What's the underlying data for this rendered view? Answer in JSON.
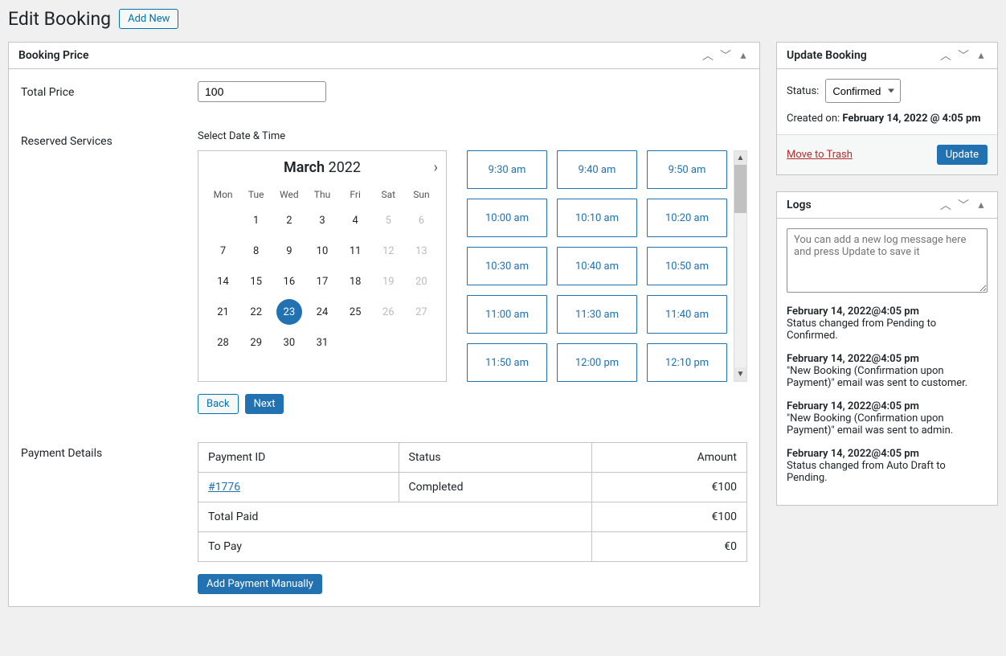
{
  "header": {
    "title": "Edit Booking",
    "add_new": "Add New"
  },
  "booking_price_panel": {
    "title": "Booking Price"
  },
  "total_price": {
    "label": "Total Price",
    "value": "100"
  },
  "reserved_services": {
    "label": "Reserved Services",
    "select_label": "Select Date & Time"
  },
  "calendar": {
    "month": "March",
    "year": "2022",
    "dow": [
      "Mon",
      "Tue",
      "Wed",
      "Thu",
      "Fri",
      "Sat",
      "Sun"
    ],
    "weeks": [
      [
        {
          "d": ""
        },
        {
          "d": "1"
        },
        {
          "d": "2"
        },
        {
          "d": "3"
        },
        {
          "d": "4"
        },
        {
          "d": "5",
          "dis": true
        },
        {
          "d": "6",
          "dis": true
        }
      ],
      [
        {
          "d": "7"
        },
        {
          "d": "8"
        },
        {
          "d": "9"
        },
        {
          "d": "10"
        },
        {
          "d": "11"
        },
        {
          "d": "12",
          "dis": true
        },
        {
          "d": "13",
          "dis": true
        }
      ],
      [
        {
          "d": "14"
        },
        {
          "d": "15"
        },
        {
          "d": "16"
        },
        {
          "d": "17"
        },
        {
          "d": "18"
        },
        {
          "d": "19",
          "dis": true
        },
        {
          "d": "20",
          "dis": true
        }
      ],
      [
        {
          "d": "21"
        },
        {
          "d": "22"
        },
        {
          "d": "23",
          "sel": true
        },
        {
          "d": "24"
        },
        {
          "d": "25"
        },
        {
          "d": "26",
          "dis": true
        },
        {
          "d": "27",
          "dis": true
        }
      ],
      [
        {
          "d": "28"
        },
        {
          "d": "29"
        },
        {
          "d": "30"
        },
        {
          "d": "31"
        },
        {
          "d": ""
        },
        {
          "d": ""
        },
        {
          "d": ""
        }
      ]
    ]
  },
  "timeslots": [
    "9:30 am",
    "9:40 am",
    "9:50 am",
    "10:00 am",
    "10:10 am",
    "10:20 am",
    "10:30 am",
    "10:40 am",
    "10:50 am",
    "11:00 am",
    "11:30 am",
    "11:40 am",
    "11:50 am",
    "12:00 pm",
    "12:10 pm"
  ],
  "nav": {
    "back": "Back",
    "next": "Next"
  },
  "payment": {
    "label": "Payment Details",
    "headers": {
      "id": "Payment ID",
      "status": "Status",
      "amount": "Amount"
    },
    "rows": [
      {
        "id": "#1776",
        "status": "Completed",
        "amount": "€100"
      }
    ],
    "total_paid_label": "Total Paid",
    "total_paid": "€100",
    "to_pay_label": "To Pay",
    "to_pay": "€0",
    "add_manual": "Add Payment Manually"
  },
  "update_panel": {
    "title": "Update Booking",
    "status_label": "Status:",
    "status_value": "Confirmed",
    "created_label": "Created on:",
    "created_value": "February 14, 2022 @ 4:05 pm",
    "trash": "Move to Trash",
    "update": "Update"
  },
  "logs_panel": {
    "title": "Logs",
    "placeholder": "You can add a new log message here and press Update to save it",
    "entries": [
      {
        "ts": "February 14, 2022@4:05 pm",
        "msg": "Status changed from Pending to Confirmed."
      },
      {
        "ts": "February 14, 2022@4:05 pm",
        "msg": "\"New Booking (Confirmation upon Payment)\" email was sent to customer."
      },
      {
        "ts": "February 14, 2022@4:05 pm",
        "msg": "\"New Booking (Confirmation upon Payment)\" email was sent to admin."
      },
      {
        "ts": "February 14, 2022@4:05 pm",
        "msg": "Status changed from Auto Draft to Pending."
      }
    ]
  }
}
